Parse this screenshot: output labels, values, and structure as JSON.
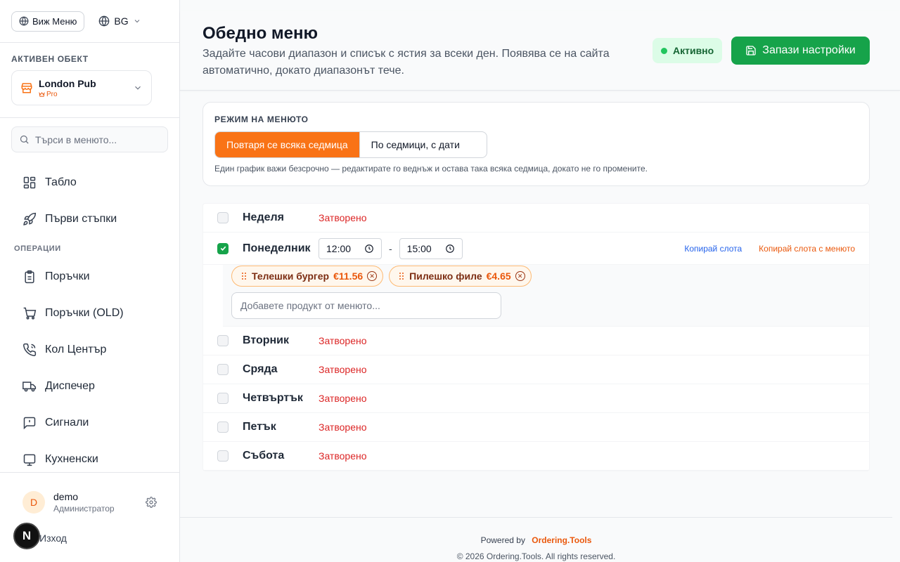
{
  "colors": {
    "accent": "#f97316",
    "success": "#16a34a",
    "danger": "#dc2626",
    "link": "#2563eb"
  },
  "sidebar": {
    "view_menu_label": "Виж Меню",
    "language": "BG",
    "active_object_label": "АКТИВЕН ОБЕКТ",
    "object_name": "London Pub",
    "object_tier": "Pro",
    "search_placeholder": "Търси в менюто...",
    "nav_main": [
      {
        "label": "Табло",
        "icon": "dashboard-icon"
      },
      {
        "label": "Първи стъпки",
        "icon": "rocket-icon"
      }
    ],
    "section_operations": "ОПЕРАЦИИ",
    "nav_operations": [
      {
        "label": "Поръчки",
        "icon": "clipboard-icon"
      },
      {
        "label": "Поръчки (OLD)",
        "icon": "cart-icon"
      },
      {
        "label": "Кол Център",
        "icon": "phone-icon"
      },
      {
        "label": "Диспечер",
        "icon": "truck-icon"
      },
      {
        "label": "Сигнали",
        "icon": "alert-message-icon"
      },
      {
        "label": "Кухненски",
        "icon": "kitchen-icon"
      }
    ],
    "user": {
      "initial": "D",
      "name": "demo",
      "role": "Администратор"
    },
    "logout_label": "Изход",
    "badge_letter": "N"
  },
  "header": {
    "title": "Обедно меню",
    "description": "Задайте часови диапазон и списък с ястия за всеки ден. Появява се на сайта автоматично, докато диапазонът тече.",
    "status": "Активно",
    "save_label": "Запази настройки"
  },
  "mode": {
    "label": "РЕЖИМ НА МЕНЮТО",
    "options": [
      "Повтаря се всяка седмица",
      "По седмици, с дати"
    ],
    "selected": "Повтаря се всяка седмица",
    "hint": "Един график важи безсрочно — редактирате го веднъж и остава така всяка седмица, докато не го промените."
  },
  "days": {
    "closed_label": "Затворено",
    "sunday": "Неделя",
    "monday": {
      "name": "Понеделник",
      "from": "12:00",
      "to": "15:00",
      "copy_slot": "Копирай слота",
      "copy_slot_menu": "Копирай слота с менюто",
      "items": [
        {
          "name": "Телешки бургер",
          "price": "€11.56"
        },
        {
          "name": "Пилешко филе",
          "price": "€4.65"
        }
      ],
      "add_placeholder": "Добавете продукт от менюто..."
    },
    "rest": [
      "Вторник",
      "Сряда",
      "Четвъртък",
      "Петък",
      "Събота"
    ]
  },
  "footer": {
    "powered_by": "Powered by",
    "brand": "Ordering.Tools",
    "copyright": "© 2026 Ordering.Tools. All rights reserved."
  }
}
